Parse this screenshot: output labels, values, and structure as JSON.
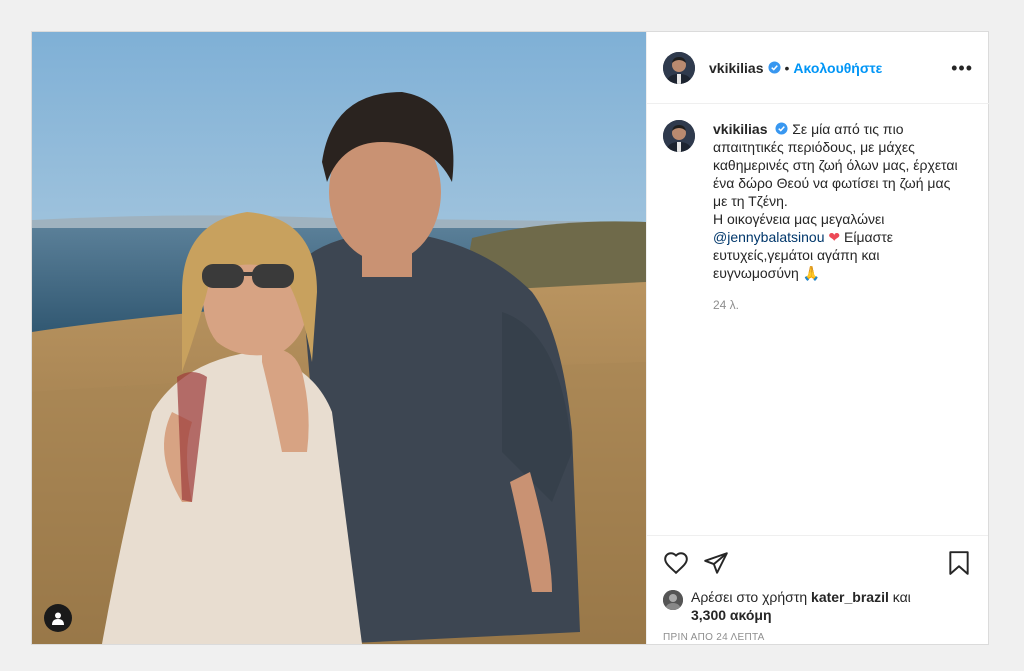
{
  "post": {
    "username": "vkikilias",
    "follow_separator": "•",
    "follow_label": "Ακολουθήστε",
    "more_label": "•••",
    "caption": {
      "line1": "Σε μία από τις πιο απαιτητικές περιόδους, με μάχες καθημερινές στη ζωή όλων μας, έρχεται ένα δώρο Θεού να φωτίσει τη ζωή μας με τη Τζένη.",
      "line2": "Η οικογένεια μας μεγαλώνει",
      "mention": "@jennybalatsinou",
      "heart": "❤",
      "line3": "Είμαστε ευτυχείς,γεμάτοι αγάπη και ευγνωμοσύνη",
      "emoji": "🙏"
    },
    "comment_time": "24 λ.",
    "likes_prefix": "Αρέσει στο χρήστη",
    "likes_user": "kater_brazil",
    "likes_and": "και",
    "likes_count": "3,300 ακόμη",
    "posted_ago": "ΠΡΙΝ ΑΠΟ 24 ΛΕΠΤΑ"
  },
  "icons": {
    "like": "heart-icon",
    "share": "paper-plane-icon",
    "save": "bookmark-icon",
    "options": "more-options-icon",
    "verified": "verified-badge-icon",
    "tag": "user-tag-icon"
  },
  "colors": {
    "accent": "#0095f6",
    "verified": "#3897f0",
    "heart": "#ed4956"
  }
}
